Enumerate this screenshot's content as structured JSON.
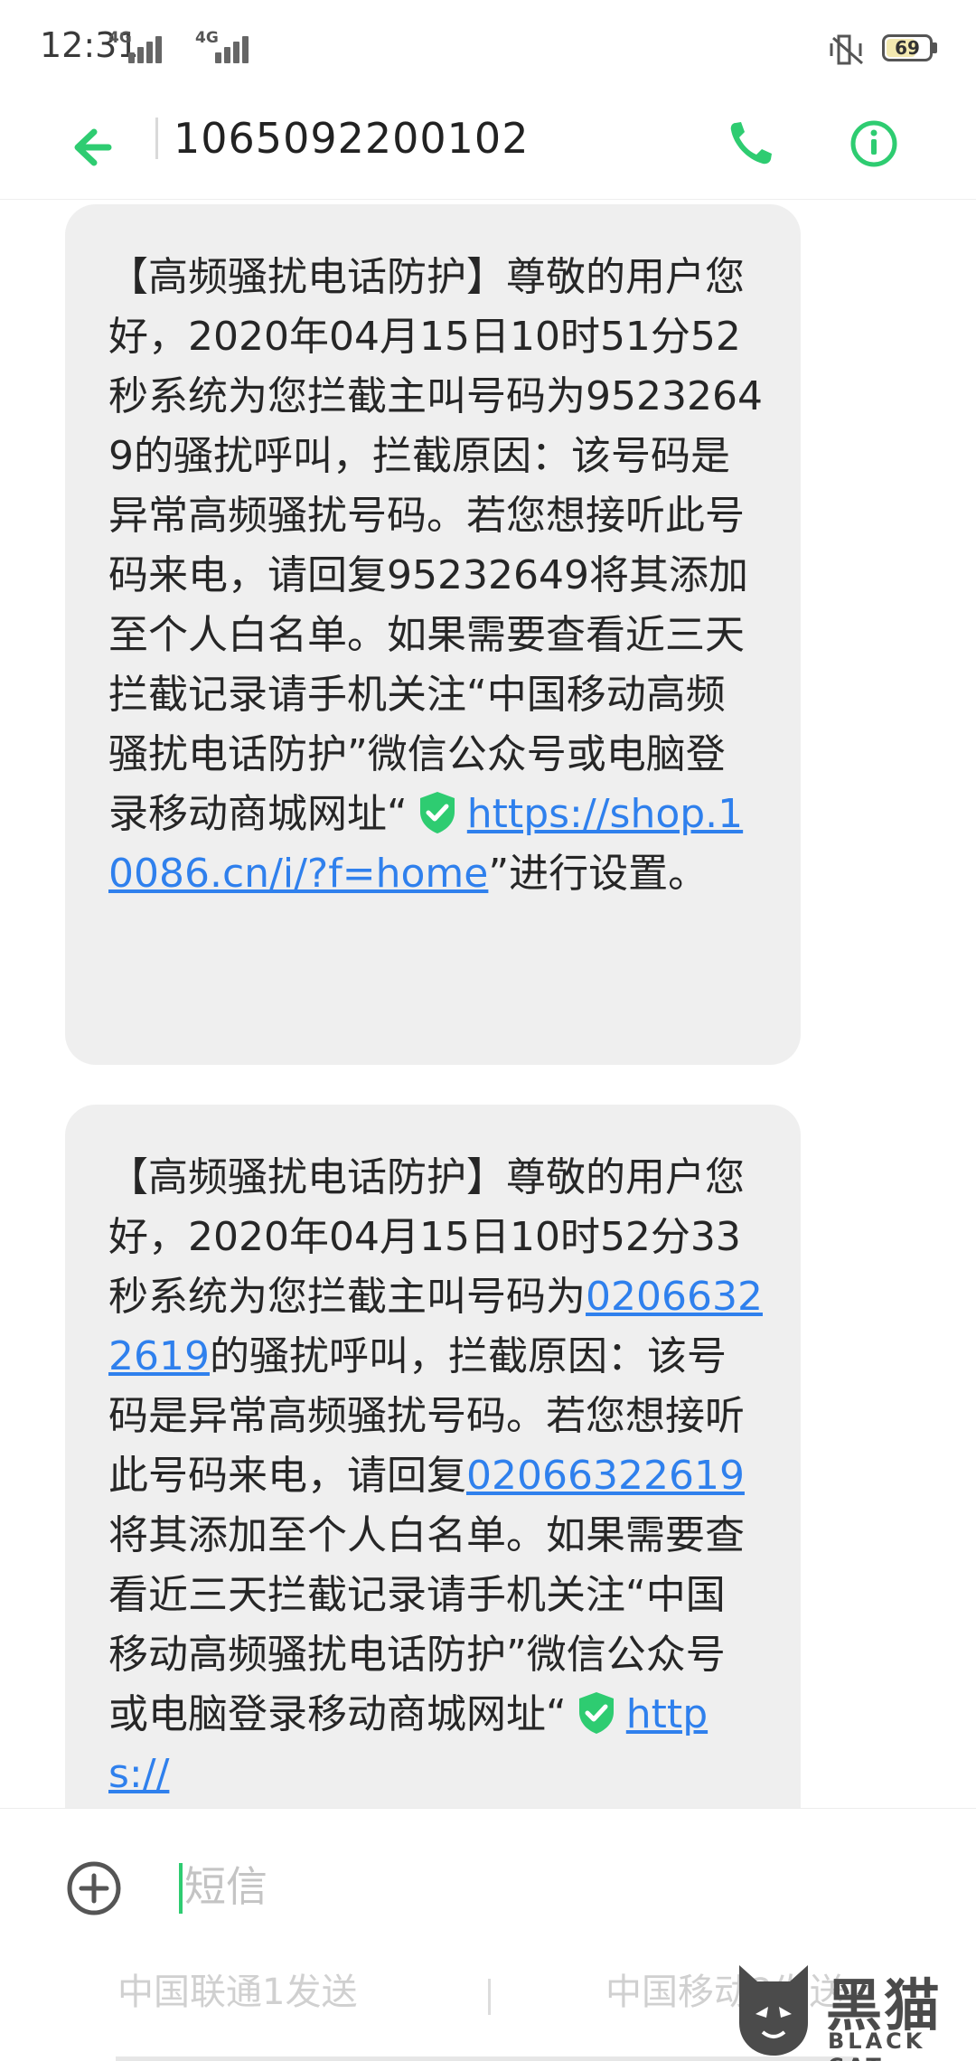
{
  "status_bar": {
    "time": "12:31",
    "network_1": "4G",
    "network_2": "4G",
    "battery": "69",
    "battery_level_percent": 69
  },
  "header": {
    "contact_number": "1065092200102"
  },
  "messages": [
    {
      "text_before_link": "【高频骚扰电话防护】尊敬的用户您好，2020年04月15日10时51分52秒系统为您拦截主叫号码为95232649的骚扰呼叫，拦截原因：该号码是异常高频骚扰号码。若您想接听此号码来电，请回复95232649将其添加至个人白名单。如果需要查看近三天拦截记录请手机关注“中国移动高频骚扰电话防护”微信公众号或电脑登录移动商城网址“",
      "link": "https://shop.10086.cn/i/?f=home",
      "text_after_link": "”进行设置。"
    },
    {
      "text_a": "【高频骚扰电话防护】尊敬的用户您好，2020年04月15日10时52分33秒系统为您拦截主叫号码为",
      "number_link_1": "02066322619",
      "text_b": "的骚扰呼叫，拦截原因：该号码是异常高频骚扰号码。若您想接听此号码来电，请回复",
      "number_link_2": "02066322619",
      "text_c": "将其添加至个人白名单。如果需要查看近三天拦截记录请手机关注“中国移动高频骚扰电话防护”微信公众号或电脑登录移动商城网址“",
      "link_partial": "https://"
    }
  ],
  "compose": {
    "placeholder": "短信",
    "sim_1_label": "中国联通1发送",
    "sim_2_label": "中国移动2发送"
  },
  "watermark": {
    "cn": "黑猫",
    "en": "BLACK CAT"
  },
  "colors": {
    "accent": "#2ecc71",
    "link": "#2f80ed",
    "bubble": "#efefef"
  }
}
